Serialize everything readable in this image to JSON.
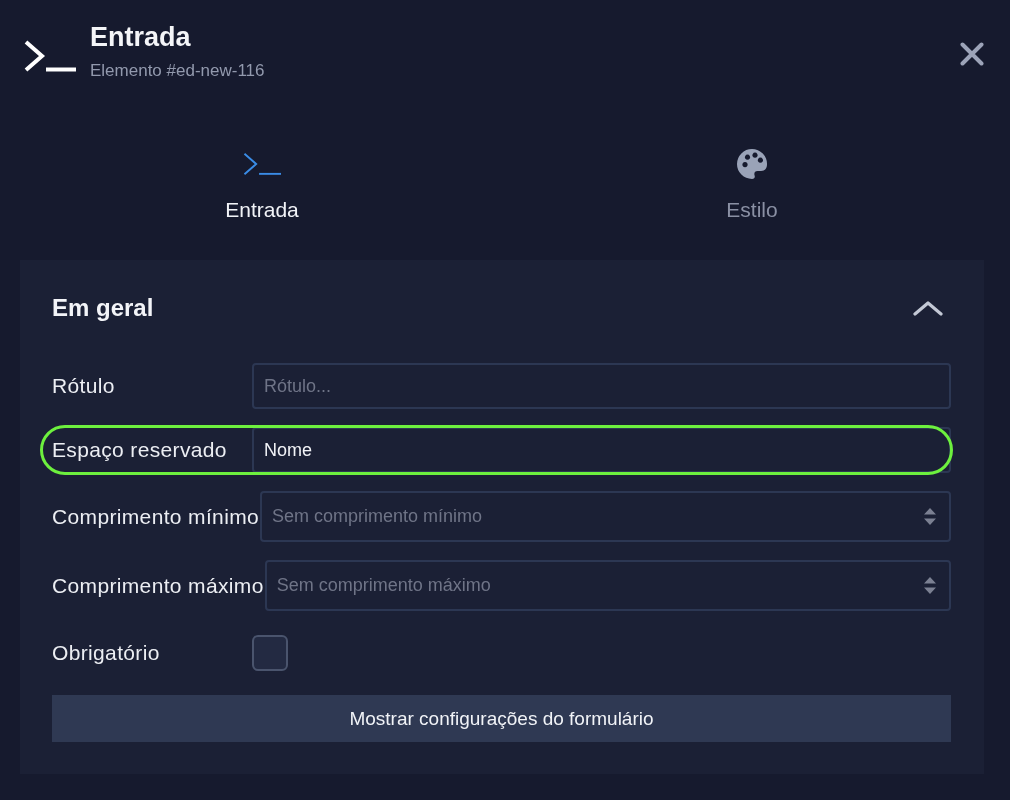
{
  "header": {
    "title": "Entrada",
    "subtitle": "Elemento #ed-new-116"
  },
  "tabs": [
    {
      "kind": "input",
      "label": "Entrada",
      "selected": true
    },
    {
      "kind": "style",
      "label": "Estilo",
      "selected": false
    }
  ],
  "section": {
    "title": "Em geral",
    "expanded": true,
    "fields": [
      {
        "kind": "text",
        "label": "Rótulo",
        "placeholder": "Rótulo...",
        "highlighted": false
      },
      {
        "kind": "text",
        "label": "Espaço reservado",
        "value": "Nome",
        "highlighted": true
      },
      {
        "kind": "number",
        "label": "Comprimento mínimo",
        "placeholder": "Sem comprimento mínimo",
        "highlighted": false
      },
      {
        "kind": "number",
        "label": "Comprimento máximo",
        "placeholder": "Sem comprimento máximo",
        "highlighted": false
      },
      {
        "kind": "checkbox",
        "label": "Obrigatório",
        "checked": false,
        "highlighted": false
      }
    ],
    "button": "Mostrar configurações do formulário"
  }
}
